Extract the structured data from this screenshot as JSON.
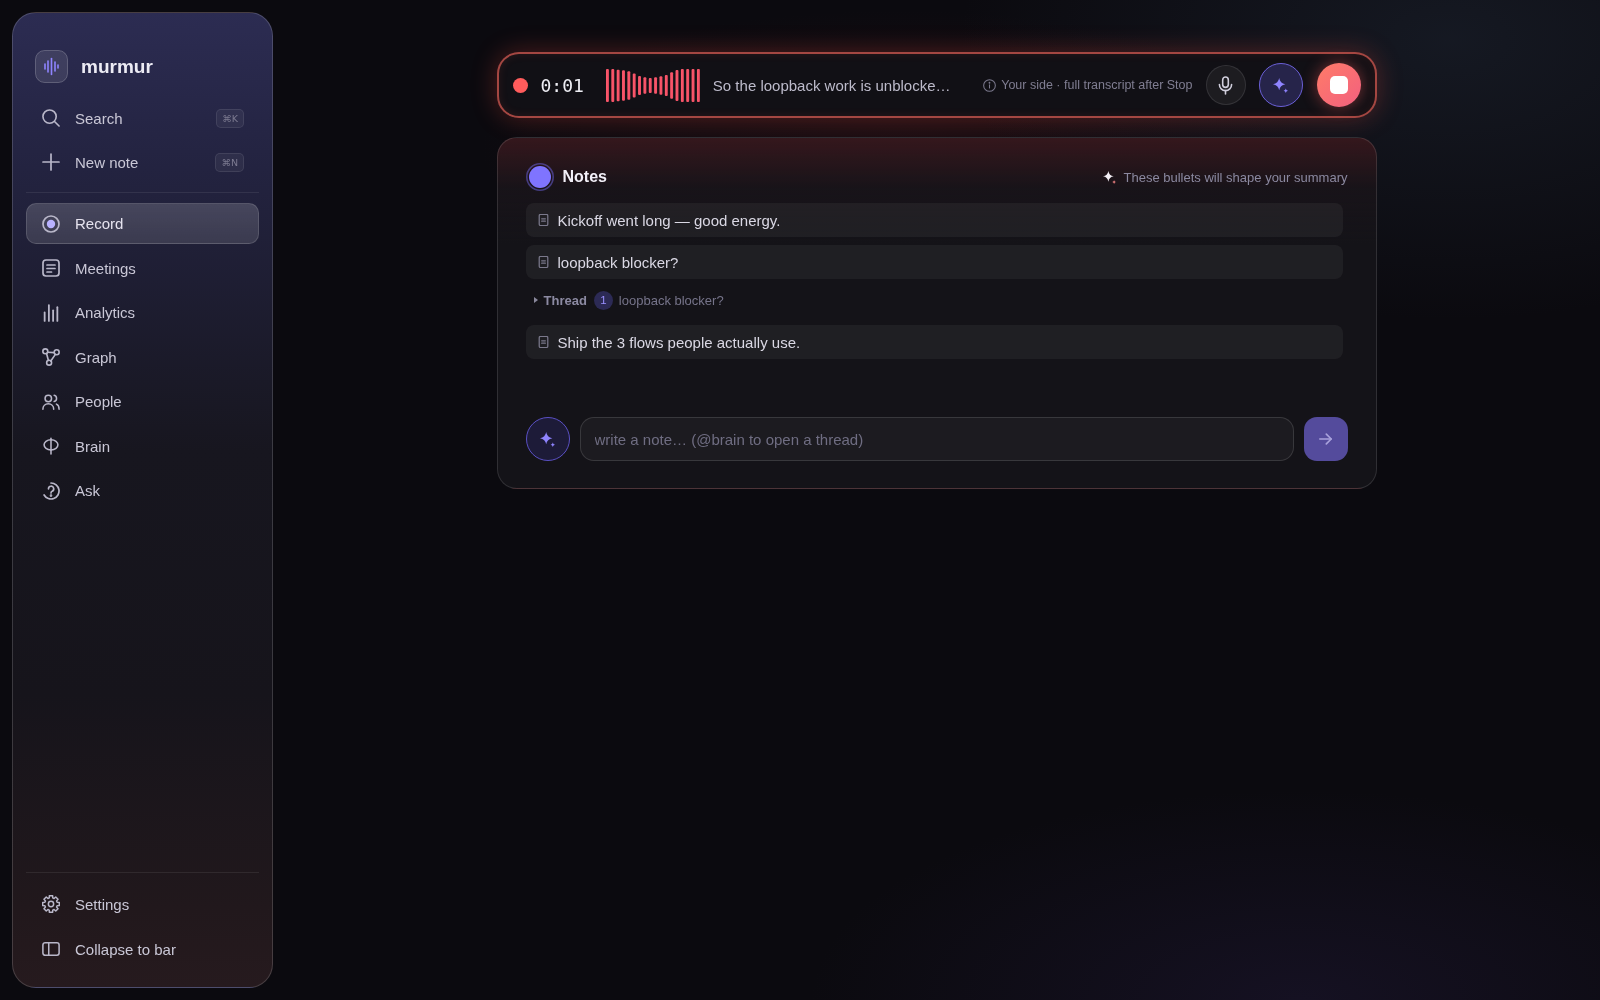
{
  "sidebar": {
    "brand": "murmur",
    "actions": [
      {
        "label": "Search",
        "shortcut": "⌘K"
      },
      {
        "label": "New note",
        "shortcut": "⌘N"
      }
    ],
    "nav": [
      {
        "label": "Record",
        "selected": true
      },
      {
        "label": "Meetings",
        "selected": false
      },
      {
        "label": "Analytics",
        "selected": false
      },
      {
        "label": "Graph",
        "selected": false
      },
      {
        "label": "People",
        "selected": false
      },
      {
        "label": "Brain",
        "selected": false
      },
      {
        "label": "Ask",
        "selected": false
      }
    ],
    "footer": [
      {
        "label": "Settings"
      },
      {
        "label": "Collapse to bar"
      }
    ]
  },
  "recording_bar": {
    "recording": true,
    "elapsed": "0:01",
    "transcript": "So the loopback work is unblocke…",
    "hint": "Your side · full transcript after Stop"
  },
  "notes": {
    "title": "Notes",
    "hint": "These bullets will shape your summary",
    "items": [
      {
        "kind": "note",
        "text": "Kickoff went long — good energy."
      },
      {
        "kind": "note",
        "text": "loopback blocker?"
      },
      {
        "kind": "thread",
        "expanded": false,
        "label": "Thread",
        "count": "1",
        "text": "loopback blocker?"
      },
      {
        "kind": "note",
        "text": "Ship the 3 flows people actually use."
      }
    ],
    "composer": {
      "placeholder": "write a note… (@brain to open a thread)"
    }
  }
}
